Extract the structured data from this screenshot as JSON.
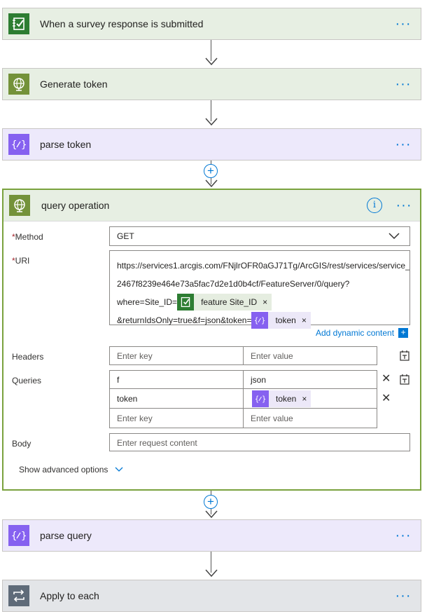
{
  "steps": {
    "survey": {
      "title": "When a survey response is submitted",
      "icon": "survey-check-icon",
      "color": "#2d7d32",
      "more": "···"
    },
    "generate": {
      "title": "Generate token",
      "icon": "globe-http-icon",
      "color": "#74923a",
      "more": "···"
    },
    "parse_token": {
      "title": "parse token",
      "icon": "json-braces-icon",
      "color": "#8661f0",
      "more": "···"
    },
    "parse_query": {
      "title": "parse query",
      "icon": "json-braces-icon",
      "color": "#8661f0",
      "more": "···"
    },
    "apply": {
      "title": "Apply to each",
      "icon": "loop-icon",
      "color": "#5f6b79",
      "more": "···"
    }
  },
  "insert": {
    "plus": "+"
  },
  "query_operation": {
    "title": "query operation",
    "info": "i",
    "more": "···",
    "method": {
      "required": "*",
      "label": "Method",
      "value": "GET"
    },
    "uri": {
      "required": "*",
      "label": "URI",
      "line1": "https://services1.arcgis.com/FNjlrOFR0aGJ71Tg/ArcGIS/rest/services/service_",
      "line2": "2467f8239e464e73a5fac7d2e1d0b4cf/FeatureServer/0/query?",
      "line3_prefix": "where=Site_ID=",
      "token_site": "feature Site_ID",
      "line4_prefix": "&returnIdsOnly=true&f=json&token=",
      "token_token": "token",
      "token_close": "×"
    },
    "dynamic_content": "Add dynamic content",
    "headers": {
      "label": "Headers",
      "key_placeholder": "Enter key",
      "value_placeholder": "Enter value"
    },
    "queries": {
      "label": "Queries",
      "rows": [
        {
          "key": "f",
          "value": "json"
        },
        {
          "key": "token",
          "value_token": "token"
        }
      ],
      "key_placeholder": "Enter key",
      "value_placeholder": "Enter value"
    },
    "body": {
      "label": "Body",
      "placeholder": "Enter request content"
    },
    "advanced": "Show advanced options"
  }
}
